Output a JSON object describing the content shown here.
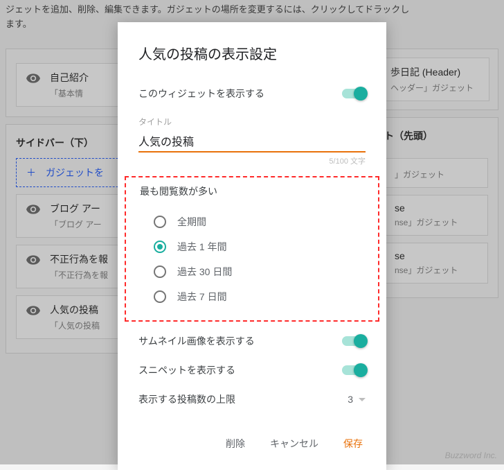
{
  "background": {
    "desc_text": "ジェットを追加、削除、編集できます。ガジェットの場所を変更するには、クリックしてドラックし\nます。",
    "cards": [
      {
        "title": "自己紹介",
        "sub": "「基本情"
      },
      {
        "title": "ブログ アー",
        "sub": "「ブログ アー"
      },
      {
        "title": "不正行為を報",
        "sub": "「不正行為を報"
      },
      {
        "title": "人気の投稿",
        "sub": "「人気の投稿"
      }
    ],
    "sidebar_label": "サイドバー（下）",
    "add_gadget": "ガジェットを",
    "right_header": "歩日記 (Header)",
    "right_header_sub": "ヘッダー」ガジェット",
    "right_section": "ト（先頭）",
    "right_g1": "」ガジェット",
    "right_g2": "se",
    "right_g2b": "nse」ガジェット",
    "right_g3": "se",
    "right_g3b": "nse」ガジェット",
    "watermark": "Buzzword Inc."
  },
  "modal": {
    "title": "人気の投稿の表示設定",
    "show_label": "このウィジェットを表示する",
    "title_field_label": "タイトル",
    "title_value": "人気の投稿",
    "char_count": "5/100 文字",
    "group_label": "最も閲覧数が多い",
    "radios": [
      "全期間",
      "過去 1 年間",
      "過去 30 日間",
      "過去 7 日間"
    ],
    "radio_selected_index": 1,
    "thumb_label": "サムネイル画像を表示する",
    "snippet_label": "スニペットを表示する",
    "limit_label": "表示する投稿数の上限",
    "limit_value": "3",
    "actions": {
      "delete": "削除",
      "cancel": "キャンセル",
      "save": "保存"
    }
  }
}
